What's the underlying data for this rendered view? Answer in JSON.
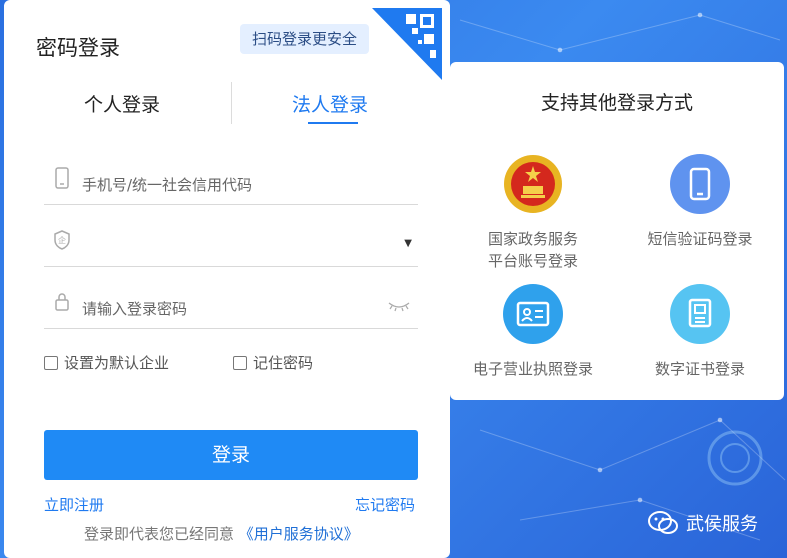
{
  "login": {
    "title": "密码登录",
    "qr_tip": "扫码登录更安全",
    "tabs": [
      "个人登录",
      "法人登录"
    ],
    "phone_placeholder": "手机号/统一社会信用代码",
    "corp_select_value": "",
    "password_placeholder": "请输入登录密码",
    "checkbox_default_company": "设置为默认企业",
    "checkbox_remember": "记住密码",
    "submit_label": "登录",
    "register_link": "立即注册",
    "forgot_link": "忘记密码",
    "agreement_prefix": "登录即代表您已经同意",
    "agreement_link": "《用户服务协议》"
  },
  "other_methods": {
    "title": "支持其他登录方式",
    "items": [
      {
        "line1": "国家政务服务",
        "line2": "平台账号登录",
        "icon": "national-emblem-icon"
      },
      {
        "line1": "短信验证码登录",
        "line2": "",
        "icon": "phone-icon"
      },
      {
        "line1": "电子营业执照登录",
        "line2": "",
        "icon": "business-license-icon"
      },
      {
        "line1": "数字证书登录",
        "line2": "",
        "icon": "digital-certificate-icon"
      }
    ]
  },
  "watermark": {
    "text": "武侯服务"
  },
  "colors": {
    "accent": "#1f8af5",
    "background": "#2f7ae8"
  }
}
